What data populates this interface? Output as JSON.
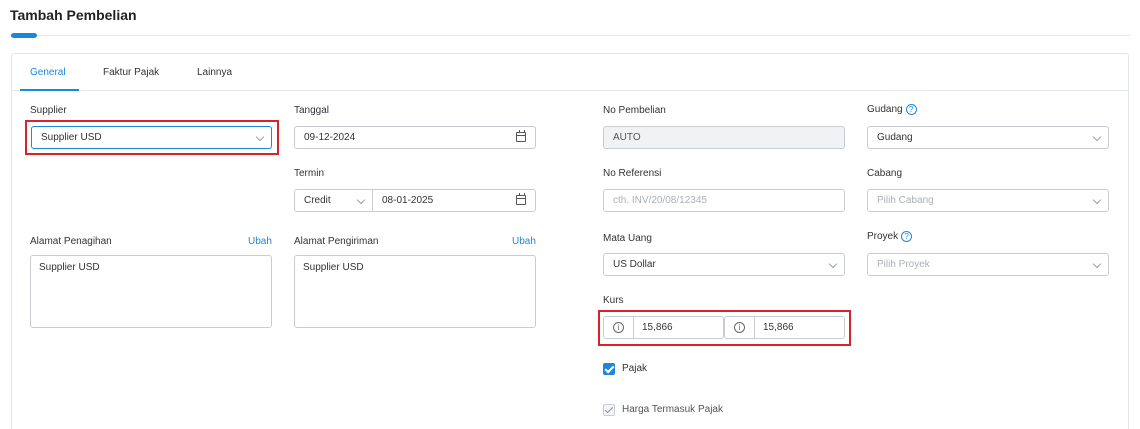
{
  "page": {
    "title": "Tambah Pembelian"
  },
  "tabs": [
    {
      "label": "General",
      "active": true
    },
    {
      "label": "Faktur Pajak",
      "active": false
    },
    {
      "label": "Lainnya",
      "active": false
    }
  ],
  "form": {
    "supplier": {
      "label": "Supplier",
      "value": "Supplier USD"
    },
    "tanggal": {
      "label": "Tanggal",
      "value": "09-12-2024"
    },
    "termin": {
      "label": "Termin",
      "type_value": "Credit",
      "date_value": "08-01-2025"
    },
    "no_pembelian": {
      "label": "No Pembelian",
      "value": "AUTO"
    },
    "no_referensi": {
      "label": "No Referensi",
      "placeholder": "cth. INV/20/08/12345"
    },
    "gudang": {
      "label": "Gudang",
      "value": "Gudang"
    },
    "cabang": {
      "label": "Cabang",
      "placeholder": "Pilih Cabang"
    },
    "proyek": {
      "label": "Proyek",
      "placeholder": "Pilih Proyek"
    },
    "alamat_penagihan": {
      "label": "Alamat Penagihan",
      "link": "Ubah",
      "value": "Supplier USD"
    },
    "alamat_pengiriman": {
      "label": "Alamat Pengiriman",
      "link": "Ubah",
      "value": "Supplier USD"
    },
    "mata_uang": {
      "label": "Mata Uang",
      "value": "US Dollar"
    },
    "kurs": {
      "label": "Kurs",
      "value1": "15,866",
      "value2": "15,866"
    },
    "pajak": {
      "label": "Pajak",
      "checked": true
    },
    "harga_termasuk_pajak": {
      "label": "Harga Termasuk Pajak",
      "checked": true,
      "disabled": true
    }
  },
  "icons": {
    "help": "?",
    "info": "i"
  },
  "colors": {
    "accent": "#1e88d8",
    "highlight": "#d9232a"
  }
}
